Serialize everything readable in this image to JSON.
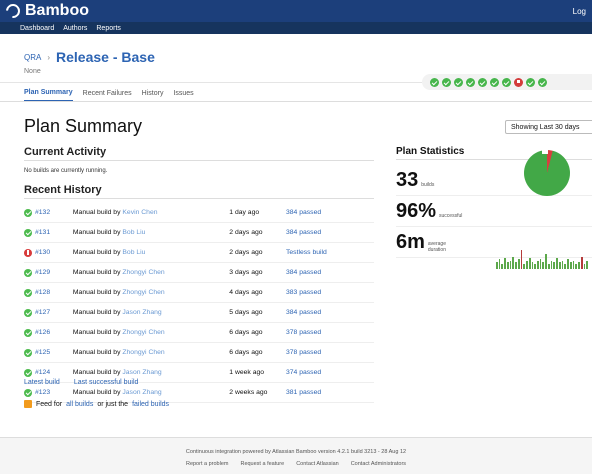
{
  "app": {
    "name": "Bamboo",
    "login": "Log"
  },
  "nav": {
    "items": [
      "Dashboard",
      "Authors",
      "Reports"
    ]
  },
  "header": {
    "project": "QRA",
    "plan": "Release - Base",
    "subtitle": "None"
  },
  "history_dots": [
    "ok",
    "ok",
    "ok",
    "ok",
    "ok",
    "ok",
    "ok",
    "bad",
    "ok",
    "ok"
  ],
  "tabs": [
    "Plan Summary",
    "Recent Failures",
    "History",
    "Issues"
  ],
  "page": {
    "title": "Plan Summary",
    "filter": "Showing Last 30 days"
  },
  "current": {
    "title": "Current Activity",
    "text": "No builds are currently running."
  },
  "recent": {
    "title": "Recent History",
    "rows": [
      {
        "build": "#132",
        "reason": "Manual build by",
        "user": "Kevin Chen",
        "time": "1 day ago",
        "result": "384 passed",
        "status": "ok"
      },
      {
        "build": "#131",
        "reason": "Manual build by",
        "user": "Bob Liu",
        "time": "2 days ago",
        "result": "384 passed",
        "status": "ok"
      },
      {
        "build": "#130",
        "reason": "Manual build by",
        "user": "Bob Liu",
        "time": "2 days ago",
        "result": "Testless build",
        "status": "bad"
      },
      {
        "build": "#129",
        "reason": "Manual build by",
        "user": "Zhongyi Chen",
        "time": "3 days ago",
        "result": "384 passed",
        "status": "ok"
      },
      {
        "build": "#128",
        "reason": "Manual build by",
        "user": "Zhongyi Chen",
        "time": "4 days ago",
        "result": "383 passed",
        "status": "ok"
      },
      {
        "build": "#127",
        "reason": "Manual build by",
        "user": "Jason Zhang",
        "time": "5 days ago",
        "result": "384 passed",
        "status": "ok"
      },
      {
        "build": "#126",
        "reason": "Manual build by",
        "user": "Zhongyi Chen",
        "time": "6 days ago",
        "result": "378 passed",
        "status": "ok"
      },
      {
        "build": "#125",
        "reason": "Manual build by",
        "user": "Zhongyi Chen",
        "time": "6 days ago",
        "result": "378 passed",
        "status": "ok"
      },
      {
        "build": "#124",
        "reason": "Manual build by",
        "user": "Jason Zhang",
        "time": "1 week ago",
        "result": "374 passed",
        "status": "ok"
      },
      {
        "build": "#123",
        "reason": "Manual build by",
        "user": "Jason Zhang",
        "time": "2 weeks ago",
        "result": "381 passed",
        "status": "ok"
      }
    ]
  },
  "links": {
    "latest": "Latest build",
    "successful": "Last successful build",
    "feed_prefix": "Feed for",
    "feed_all": "all builds",
    "feed_middle": "or just the",
    "feed_failed": "failed builds"
  },
  "stats": {
    "title": "Plan Statistics",
    "builds": "33",
    "builds_label": "builds",
    "success": "96%",
    "success_label": "successful",
    "duration": "6m",
    "duration_label": "average duration",
    "success_fraction": 0.96,
    "bar_heights": [
      5,
      7,
      4,
      8,
      5,
      6,
      9,
      5,
      7,
      14,
      4,
      6,
      8,
      5,
      4,
      6,
      7,
      5,
      11,
      4,
      6,
      5,
      8,
      5,
      6,
      4,
      7,
      5,
      6,
      4,
      5,
      9,
      4,
      6
    ]
  },
  "footer": {
    "line1": "Continuous integration powered by Atlassian Bamboo version 4.2.1 build 3213 - 28 Aug 12",
    "line2": [
      "Report a problem",
      "Request a feature",
      "Contact Atlassian",
      "Contact Administrators"
    ]
  }
}
